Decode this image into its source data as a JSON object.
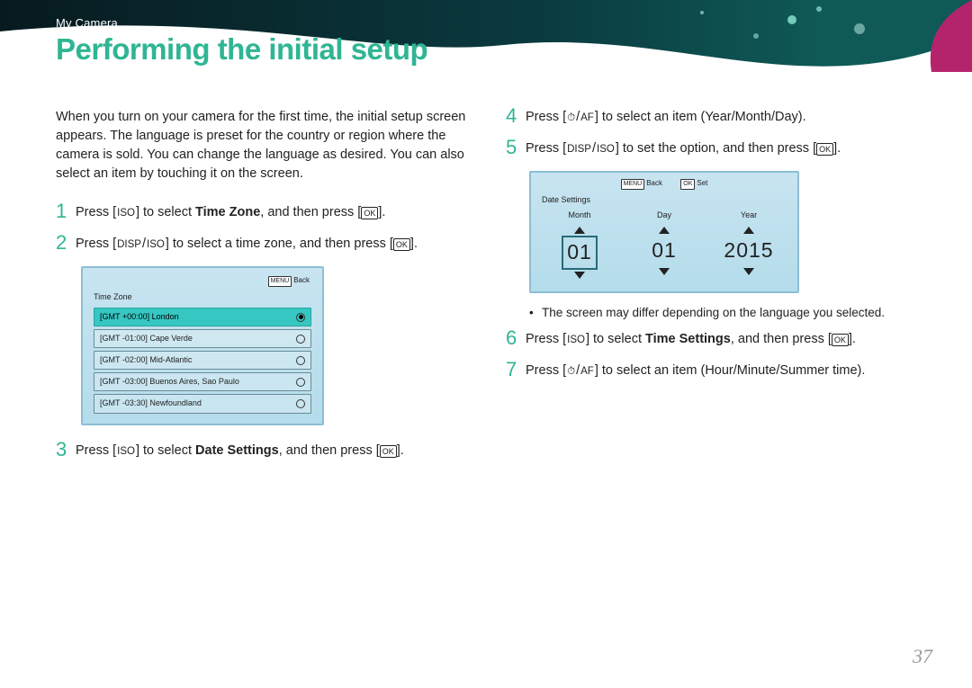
{
  "header": {
    "breadcrumb": "My Camera",
    "title": "Performing the initial setup"
  },
  "intro": "When you turn on your camera for the first time, the initial setup screen appears. The language is preset for the country or region where the camera is sold. You can change the language as desired. You can also select an item by touching it on the screen.",
  "keys": {
    "iso": "ISO",
    "disp": "DISP",
    "af": "AF",
    "ok": "OK",
    "timer": "⏱"
  },
  "steps": {
    "s1": {
      "num": "1",
      "pre": "Press [",
      "mid1": "] to select ",
      "bold": "Time Zone",
      "mid2": ", and then press [",
      "post": "]."
    },
    "s2": {
      "num": "2",
      "pre": "Press [",
      "mid": "] to select a time zone, and then press [",
      "post": "]."
    },
    "s3": {
      "num": "3",
      "pre": "Press [",
      "mid1": "] to select ",
      "bold": "Date Settings",
      "mid2": ", and then press [",
      "post": "]."
    },
    "s4": {
      "num": "4",
      "pre": "Press [",
      "mid": "] to select an item (Year/Month/Day).",
      "slash": "/"
    },
    "s5": {
      "num": "5",
      "pre": "Press [",
      "mid": "] to set the option, and then press [",
      "post": "]."
    },
    "s6": {
      "num": "6",
      "pre": "Press [",
      "mid1": "] to select ",
      "bold": "Time Settings",
      "mid2": ", and then press [",
      "post": "]."
    },
    "s7": {
      "num": "7",
      "pre": "Press [",
      "mid": "] to select an item (Hour/Minute/Summer time).",
      "slash": "/"
    }
  },
  "tz_panel": {
    "top_menu": "MENU",
    "top_back": "Back",
    "title": "Time Zone",
    "rows": [
      {
        "label": "[GMT +00:00] London",
        "selected": true
      },
      {
        "label": "[GMT -01:00] Cape Verde",
        "selected": false
      },
      {
        "label": "[GMT -02:00] Mid-Atlantic",
        "selected": false
      },
      {
        "label": "[GMT -03:00] Buenos Aires, Sao Paulo",
        "selected": false
      },
      {
        "label": "[GMT -03:30] Newfoundland",
        "selected": false
      }
    ]
  },
  "date_panel": {
    "top_menu": "MENU",
    "top_back": "Back",
    "top_ok": "OK",
    "top_set": "Set",
    "title": "Date Settings",
    "cols": [
      {
        "hdr": "Month",
        "val": "01",
        "boxed": true
      },
      {
        "hdr": "Day",
        "val": "01",
        "boxed": false
      },
      {
        "hdr": "Year",
        "val": "2015",
        "boxed": false
      }
    ]
  },
  "note": "The screen may differ depending on the language you selected.",
  "page_number": "37"
}
